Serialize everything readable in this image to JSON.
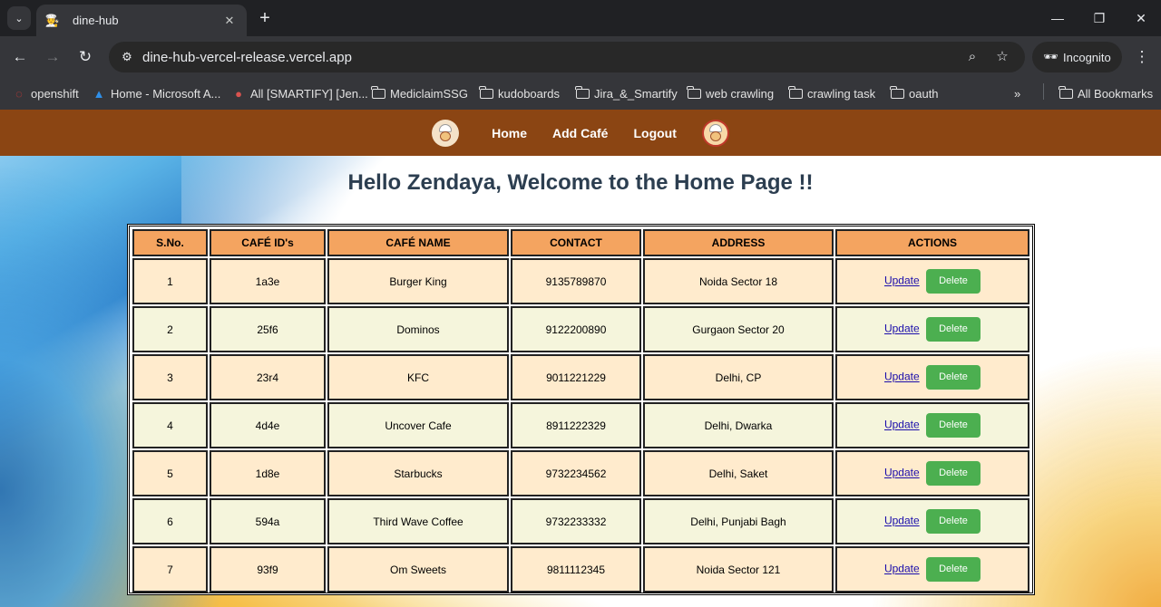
{
  "browser": {
    "tab_title": "dine-hub",
    "url": "dine-hub-vercel-release.vercel.app",
    "incognito_label": "Incognito",
    "bookmarks": [
      {
        "label": "openshift",
        "icon": "openshift-icon"
      },
      {
        "label": "Home - Microsoft A...",
        "icon": "azure-icon"
      },
      {
        "label": "All [SMARTIFY] [Jen...",
        "icon": "jenkins-icon"
      },
      {
        "label": "MediclaimSSG",
        "icon": "folder-icon"
      },
      {
        "label": "kudoboards",
        "icon": "folder-icon"
      },
      {
        "label": "Jira_&_Smartify",
        "icon": "folder-icon"
      },
      {
        "label": "web crawling",
        "icon": "folder-icon"
      },
      {
        "label": "crawling task",
        "icon": "folder-icon"
      },
      {
        "label": "oauth",
        "icon": "folder-icon"
      }
    ],
    "all_bookmarks_label": "All Bookmarks"
  },
  "app": {
    "nav": {
      "home": "Home",
      "add_cafe": "Add Café",
      "logout": "Logout"
    },
    "welcome": "Hello Zendaya, Welcome to the Home Page !!",
    "table": {
      "headers": [
        "S.No.",
        "CAFÉ ID's",
        "CAFÉ NAME",
        "CONTACT",
        "ADDRESS",
        "ACTIONS"
      ],
      "update_label": "Update",
      "delete_label": "Delete",
      "rows": [
        {
          "sno": "1",
          "id": "1a3e",
          "name": "Burger King",
          "contact": "9135789870",
          "address": "Noida Sector 18"
        },
        {
          "sno": "2",
          "id": "25f6",
          "name": "Dominos",
          "contact": "9122200890",
          "address": "Gurgaon Sector 20"
        },
        {
          "sno": "3",
          "id": "23r4",
          "name": "KFC",
          "contact": "9011221229",
          "address": "Delhi, CP"
        },
        {
          "sno": "4",
          "id": "4d4e",
          "name": "Uncover Cafe",
          "contact": "8911222329",
          "address": "Delhi, Dwarka"
        },
        {
          "sno": "5",
          "id": "1d8e",
          "name": "Starbucks",
          "contact": "9732234562",
          "address": "Delhi, Saket"
        },
        {
          "sno": "6",
          "id": "594a",
          "name": "Third Wave Coffee",
          "contact": "9732233332",
          "address": "Delhi, Punjabi Bagh"
        },
        {
          "sno": "7",
          "id": "93f9",
          "name": "Om Sweets",
          "contact": "9811112345",
          "address": "Noida Sector 121"
        }
      ]
    }
  },
  "colors": {
    "navbar": "#8b4513",
    "header_cell": "#f4a460",
    "row_odd": "#ffebcd",
    "row_even": "#f5f5dc",
    "delete_button": "#4caf50",
    "heading_text": "#2c3e50"
  }
}
